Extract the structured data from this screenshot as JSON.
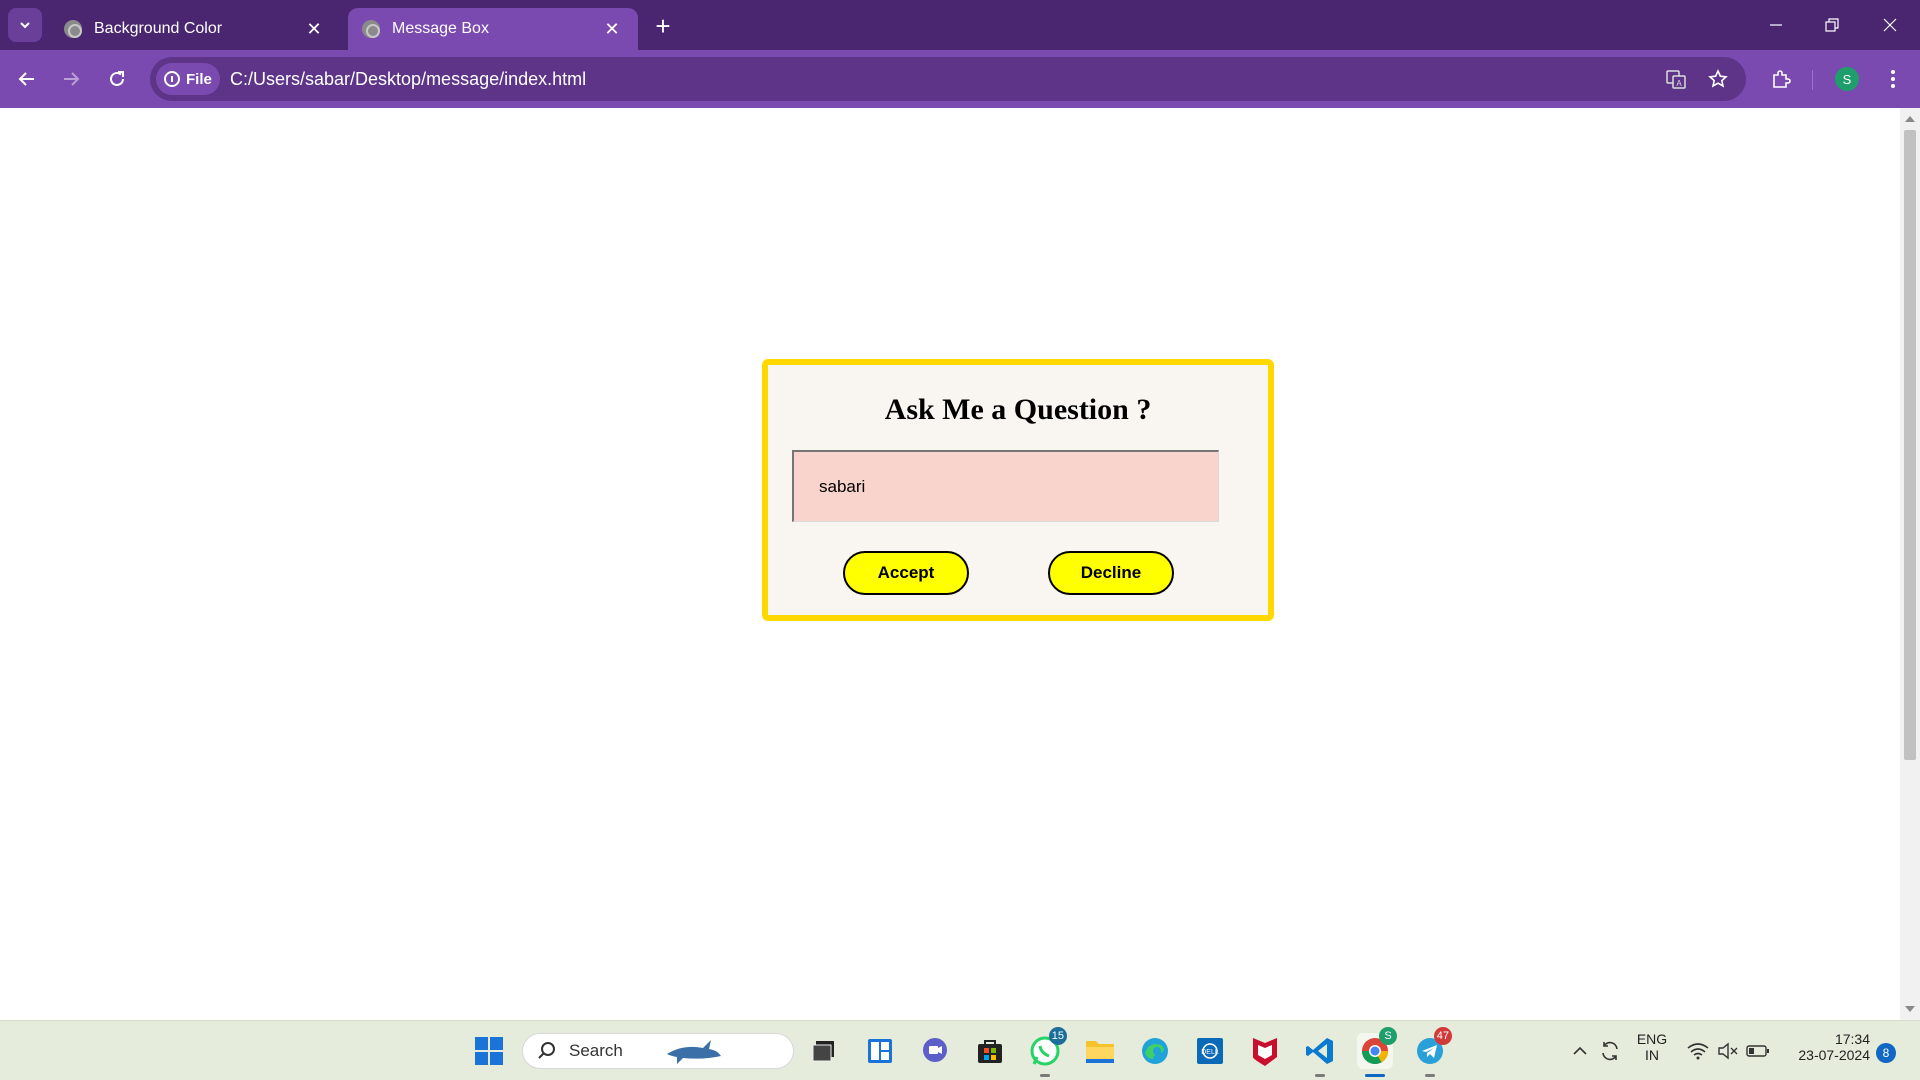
{
  "browser": {
    "tabs": [
      {
        "title": "Background Color",
        "active": false
      },
      {
        "title": "Message Box",
        "active": true
      }
    ],
    "url_chip": "File",
    "url": "C:/Users/sabar/Desktop/message/index.html",
    "profile_initial": "S"
  },
  "message_box": {
    "title": "Ask Me a Question ?",
    "input_value": "sabari",
    "accept_label": "Accept",
    "decline_label": "Decline",
    "border_color": "#ffd800",
    "button_color": "#ffff00",
    "input_bg": "#f9d4cc"
  },
  "taskbar": {
    "search_label": "Search",
    "whatsapp_badge": "15",
    "telegram_badge": "47",
    "chrome_badge": "S",
    "lang_line1": "ENG",
    "lang_line2": "IN",
    "time": "17:34",
    "date": "23-07-2024",
    "notification_count": "8"
  }
}
